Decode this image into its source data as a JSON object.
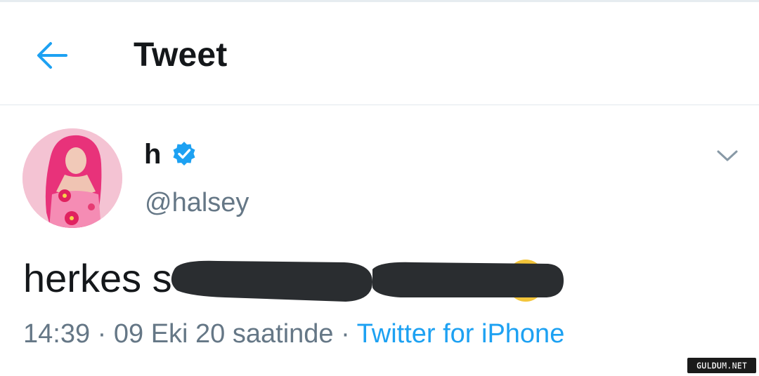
{
  "header": {
    "back_icon": "arrow-left-icon",
    "title": "Tweet"
  },
  "tweet": {
    "author": {
      "display_name": "h",
      "verified_icon": "verified-badge-icon",
      "handle": "@halsey"
    },
    "menu_icon": "chevron-down-icon",
    "text_visible": "herkes s",
    "meta": {
      "time": "14:39",
      "separator": " · ",
      "date": "09 Eki 20 saatinde",
      "source": "Twitter for iPhone"
    }
  },
  "watermark": {
    "text": "GULDUM.NET"
  },
  "colors": {
    "accent": "#1da1f2",
    "secondary_text": "#657786",
    "primary_text": "#14171a",
    "redaction": "#2a2d30"
  }
}
